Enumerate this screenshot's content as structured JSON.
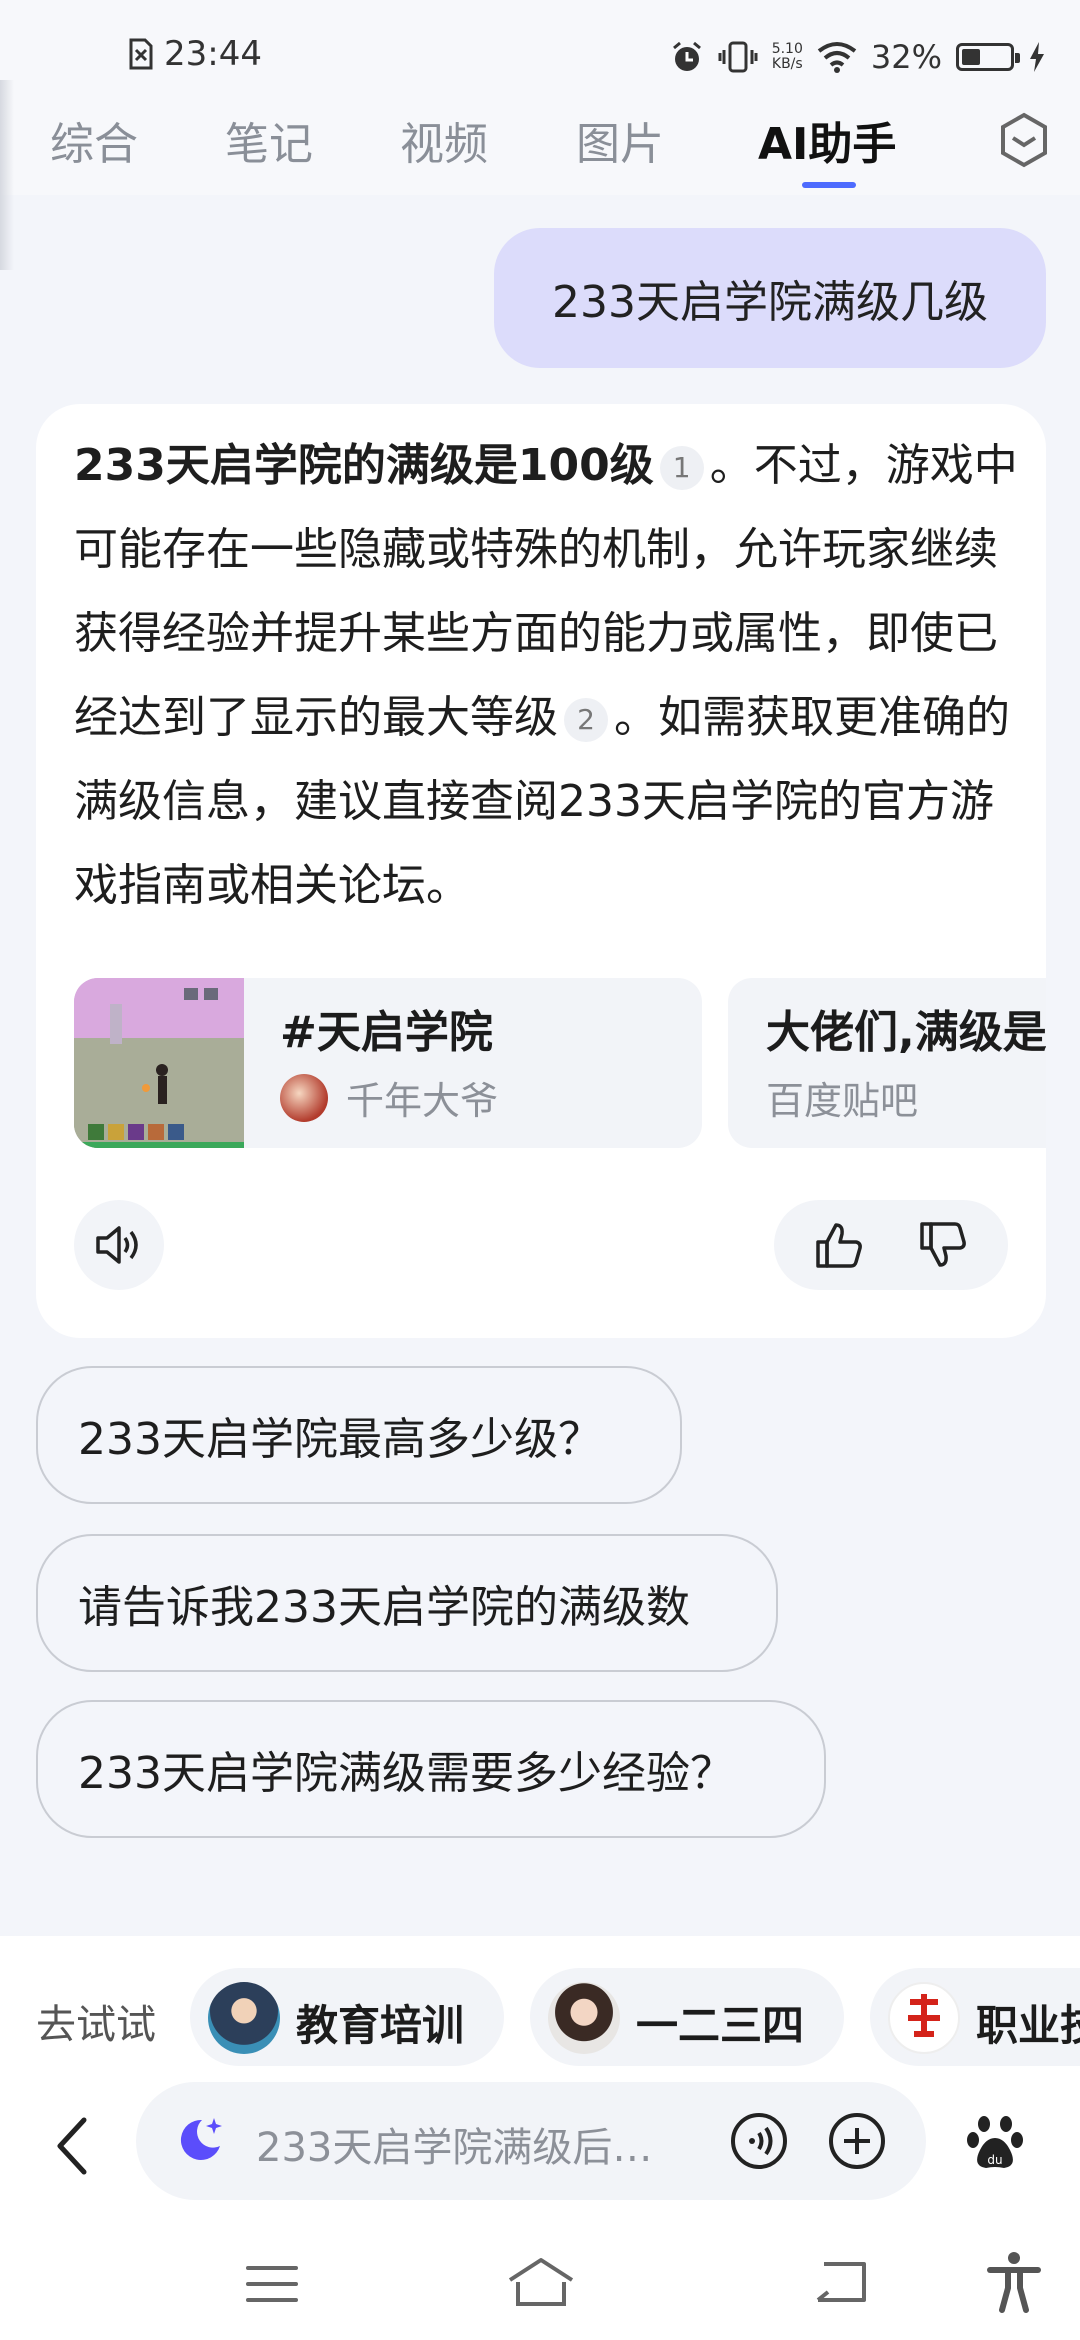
{
  "status_bar": {
    "time": "23:44",
    "net_speed_value": "5.10",
    "net_speed_unit": "KB/s",
    "battery_percent": "32%"
  },
  "tabs": [
    {
      "label": "综合",
      "active": false
    },
    {
      "label": "笔记",
      "active": false
    },
    {
      "label": "视频",
      "active": false
    },
    {
      "label": "图片",
      "active": false
    },
    {
      "label": "AI助手",
      "active": true
    }
  ],
  "chat": {
    "user_message": "233天启学院满级几级",
    "answer": {
      "bold_lead": "233天启学院的满级是100级",
      "cite_1": "1",
      "part_1": "。不过，游戏中可能存在一些隐藏或特殊的机制，允许玩家继续获得经验并提升某些方面的能力或属性，即使已经达到了显示的最大等级",
      "cite_2": "2",
      "part_2": "。如需获取更准确的满级信息，建议直接查阅233天启学院的官方游戏指南或相关论坛。"
    },
    "sources": [
      {
        "title": "#天启学院",
        "author": "千年大爷"
      },
      {
        "title": "大佬们,满级是",
        "source": "百度贴吧"
      }
    ]
  },
  "suggestions": [
    "233天启学院最高多少级？",
    "请告诉我233天启学院的满级数",
    "233天启学院满级需要多少经验？"
  ],
  "try_bar": {
    "label": "去试试",
    "agents": [
      {
        "label": "教育培训"
      },
      {
        "label": "一二三四"
      },
      {
        "label": "职业技"
      }
    ]
  },
  "input": {
    "placeholder": "233天启学院满级后…"
  },
  "colors": {
    "accent": "#4d6bfe",
    "user_bubble": "#dcdcfb",
    "page_bg": "#f3f5fa"
  }
}
